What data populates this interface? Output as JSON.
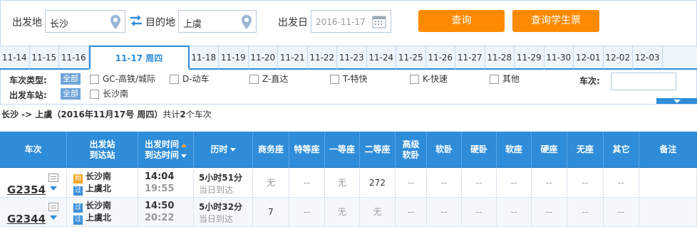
{
  "search": {
    "from_label": "出发地",
    "from_value": "长沙",
    "to_label": "目的地",
    "to_value": "上虞",
    "date_label": "出发日",
    "date_value": "2016-11-17",
    "query_button": "查询",
    "student_button": "查询学生票"
  },
  "date_tabs": [
    {
      "label": "11-14"
    },
    {
      "label": "11-15"
    },
    {
      "label": "11-16"
    },
    {
      "label": "11-17 周四",
      "active": true
    },
    {
      "label": "11-18"
    },
    {
      "label": "11-19"
    },
    {
      "label": "11-20"
    },
    {
      "label": "11-21"
    },
    {
      "label": "11-22"
    },
    {
      "label": "11-23"
    },
    {
      "label": "11-24"
    },
    {
      "label": "11-25"
    },
    {
      "label": "11-26"
    },
    {
      "label": "11-27"
    },
    {
      "label": "11-28"
    },
    {
      "label": "11-29"
    },
    {
      "label": "11-30"
    },
    {
      "label": "12-01"
    },
    {
      "label": "12-02"
    },
    {
      "label": "12-03"
    }
  ],
  "filters": {
    "type_label": "车次类型:",
    "all_label": "全部",
    "types": [
      "GC-高铁/城际",
      "D-动车",
      "Z-直达",
      "T-特快",
      "K-快速",
      "其他"
    ],
    "station_label": "出发车站:",
    "stations": [
      "长沙南"
    ],
    "train_no_label": "车次:"
  },
  "summary": {
    "route": "长沙 -> 上虞（2016年11月17号 周四）",
    "prefix": "共计",
    "count": "2",
    "suffix": "个车次"
  },
  "table": {
    "headers": {
      "train": "车次",
      "station_1": "出发站",
      "station_2": "到达站",
      "time_1": "出发时间",
      "time_2": "到达时间",
      "duration": "历时",
      "business": "商务座",
      "special": "特等座",
      "first": "一等座",
      "second": "二等座",
      "soft_sleeper_hi_1": "高级",
      "soft_sleeper_hi_2": "软卧",
      "soft_sleeper": "软卧",
      "hard_sleeper": "硬卧",
      "soft_seat": "软座",
      "hard_seat": "硬座",
      "no_seat": "无座",
      "other": "其它",
      "remark": "备注"
    },
    "rows": [
      {
        "code": "G2354",
        "from_badge": "始",
        "from": "长沙南",
        "to_badge": "过",
        "to": "上虞北",
        "depart": "14:04",
        "arrive": "19:55",
        "duration": "5小时51分",
        "arrive_day": "当日到达",
        "business": "无",
        "special": "--",
        "first": "无",
        "second": "272",
        "soft_sleeper_hi": "--",
        "soft_sleeper": "--",
        "hard_sleeper": "--",
        "soft_seat": "--",
        "hard_seat": "--",
        "no_seat": "--",
        "other": "--",
        "remark": ""
      },
      {
        "code": "G2344",
        "from_badge": "过",
        "from": "长沙南",
        "to_badge": "过",
        "to": "上虞北",
        "depart": "14:50",
        "arrive": "20:22",
        "duration": "5小时32分",
        "arrive_day": "当日到达",
        "business": "7",
        "special": "--",
        "first": "无",
        "second": "无",
        "soft_sleeper_hi": "--",
        "soft_sleeper": "--",
        "hard_sleeper": "--",
        "soft_seat": "--",
        "hard_seat": "--",
        "no_seat": "--",
        "other": "--",
        "remark": ""
      }
    ]
  },
  "colors": {
    "accent": "#2e8cd9",
    "button": "#ff8a00",
    "start_badge": "#f5a623",
    "pass_badge": "#3a8fd9"
  },
  "icons": {
    "location": "location-pin-icon",
    "swap": "swap-arrows-icon",
    "calendar": "calendar-icon"
  }
}
